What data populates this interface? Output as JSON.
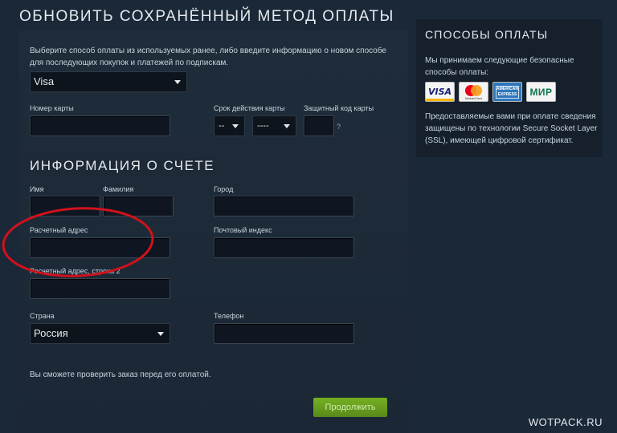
{
  "page_title": "ОБНОВИТЬ СОХРАНЁННЫЙ МЕТОД ОПЛАТЫ",
  "payment_method": {
    "description": "Выберите способ оплаты из используемых ранее, либо введите информацию о новом способе для последующих покупок и платежей по подпискам.",
    "selected": "Visa",
    "card_number_label": "Номер карты",
    "expiry_label": "Срок действия карты",
    "expiry_month": "--",
    "expiry_year": "----",
    "cvv_label": "Защитный код карты",
    "cvv_help": "?"
  },
  "billing": {
    "section_title": "ИНФОРМАЦИЯ О СЧЕТЕ",
    "first_name_label": "Имя",
    "last_name_label": "Фамилия",
    "city_label": "Город",
    "address_label": "Расчетный адрес",
    "zip_label": "Почтовый индекс",
    "address2_label": "Расчетный адрес, строка 2",
    "country_label": "Страна",
    "country_value": "Россия",
    "phone_label": "Телефон",
    "note": "Вы сможете проверить заказ перед его оплатой.",
    "continue_label": "Продолжить"
  },
  "side": {
    "title": "СПОСОБЫ ОПЛАТЫ",
    "intro": "Мы принимаем следующие безопасные способы оплаты:",
    "cards": [
      "VISA",
      "MasterCard",
      "AMERICAN EXPRESS",
      "МИР"
    ],
    "ssl_text": "Предоставляемые вами при оплате сведения защищены по технологии Secure Socket Layer (SSL), имеющей цифровой сертификат."
  },
  "watermark": "WOTPACK.RU",
  "colors": {
    "background": "#1b2838",
    "accent_green": "#75b022",
    "highlight_circle": "#d0121b"
  }
}
